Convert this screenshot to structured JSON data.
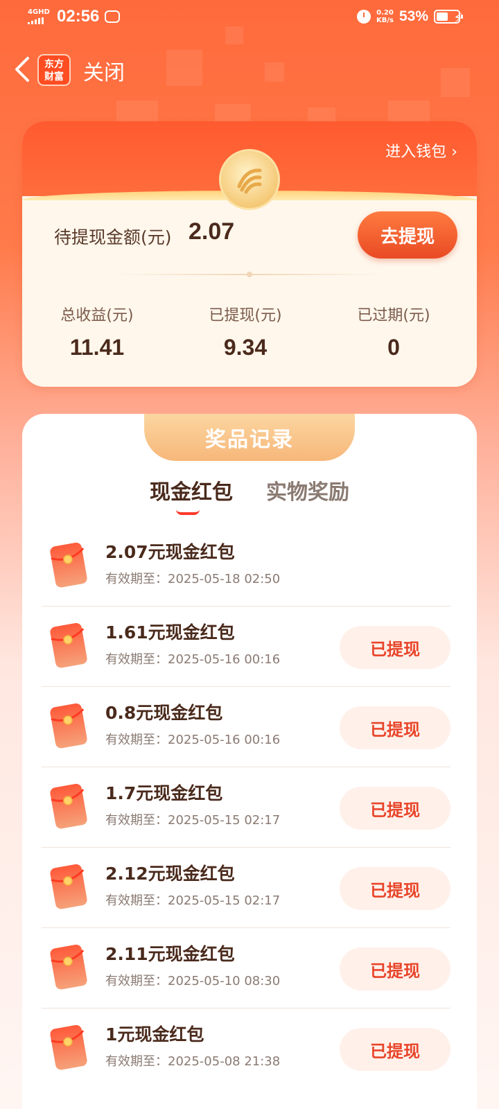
{
  "status_bar": {
    "network": "4GHD",
    "time": "02:56",
    "speed_value": "0.20",
    "speed_unit": "KB/s",
    "battery_text": "53%",
    "battery_level": 0.53
  },
  "nav": {
    "back_icon": "chevron-left-icon",
    "logo_line1": "东方",
    "logo_line2": "财富",
    "close_label": "关闭"
  },
  "wallet": {
    "enter_wallet_label": "进入钱包",
    "pending_label": "待提现金额(元)",
    "pending_value": "2.07",
    "withdraw_button": "去提现",
    "stats": [
      {
        "label": "总收益(元)",
        "value": "11.41"
      },
      {
        "label": "已提现(元)",
        "value": "9.34"
      },
      {
        "label": "已过期(元)",
        "value": "0"
      }
    ]
  },
  "records": {
    "header": "奖品记录",
    "tabs": [
      {
        "label": "现金红包",
        "active": true
      },
      {
        "label": "实物奖励",
        "active": false
      }
    ],
    "items": [
      {
        "title": "2.07元现金红包",
        "expiry": "有效期至：2025-05-18 02:50",
        "button": ""
      },
      {
        "title": "1.61元现金红包",
        "expiry": "有效期至：2025-05-16 00:16",
        "button": "已提现"
      },
      {
        "title": "0.8元现金红包",
        "expiry": "有效期至：2025-05-16 00:16",
        "button": "已提现"
      },
      {
        "title": "1.7元现金红包",
        "expiry": "有效期至：2025-05-15 02:17",
        "button": "已提现"
      },
      {
        "title": "2.12元现金红包",
        "expiry": "有效期至：2025-05-15 02:17",
        "button": "已提现"
      },
      {
        "title": "2.11元现金红包",
        "expiry": "有效期至：2025-05-10 08:30",
        "button": "已提现"
      },
      {
        "title": "1元现金红包",
        "expiry": "有效期至：2025-05-08 21:38",
        "button": "已提现"
      }
    ]
  },
  "colors": {
    "accent": "#ff5a30",
    "button_text": "#e8452a",
    "title_text": "#4a2a1c"
  }
}
